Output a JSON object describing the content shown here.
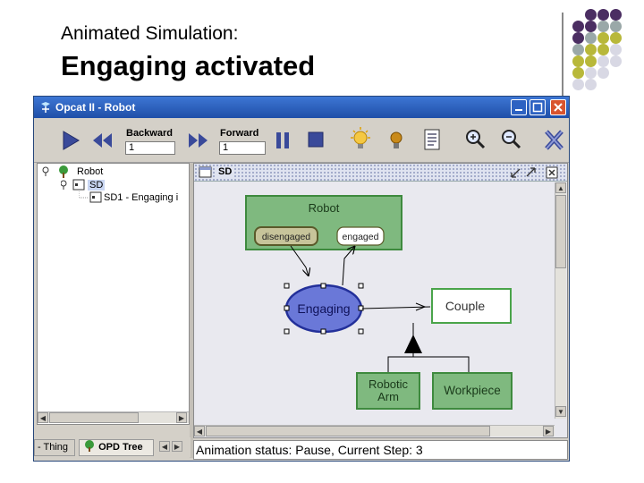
{
  "slide": {
    "subtitle": "Animated Simulation:",
    "title": "Engaging activated",
    "dot_colors": [
      "#4b2e62",
      "#9aa8a8",
      "#b8b83a",
      "#d8d8e4"
    ]
  },
  "window": {
    "title": "Opcat II - Robot"
  },
  "toolbar": {
    "backward_label": "Backward",
    "backward_value": "1",
    "forward_label": "Forward",
    "forward_value": "1",
    "icons": [
      "play-icon",
      "rewind-icon",
      "fast-forward-icon",
      "pause-icon",
      "stop-icon",
      "lightbulb-on-icon",
      "lightbulb-off-icon",
      "report-icon",
      "zoom-in-icon",
      "zoom-out-icon",
      "close-x-icon"
    ]
  },
  "tree": {
    "root": "Robot",
    "child": "SD",
    "leaf": "SD1 - Engaging i"
  },
  "tabs": [
    {
      "label": "- Thing"
    },
    {
      "label": "OPD Tree"
    }
  ],
  "diagram": {
    "tab_label": "SD",
    "object": "Robot",
    "state_1": "disengaged",
    "state_2": "engaged",
    "process": "Engaging",
    "couple": "Couple",
    "part_1": "Robotic\nArm",
    "part_2": "Workpiece",
    "colors": {
      "object_fill": "#7fb97f",
      "object_border": "#3e8a3e",
      "process_fill": "#6a78d8",
      "process_border": "#23309a",
      "couple_border": "#4aa44a"
    }
  },
  "status": {
    "text": "Animation status: Pause, Current Step: 3"
  }
}
